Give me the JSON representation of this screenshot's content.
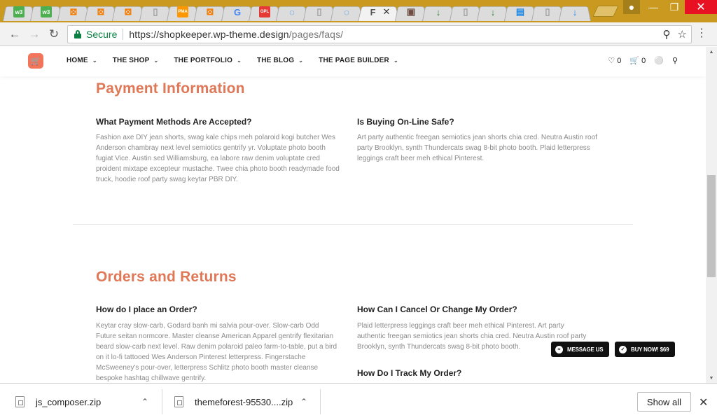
{
  "browser": {
    "tabs": [
      {
        "icon": "w3-icon",
        "glyph": "w3",
        "color": "#4caf50"
      },
      {
        "icon": "w3-icon",
        "glyph": "w3",
        "color": "#4caf50"
      },
      {
        "icon": "xampp-icon",
        "glyph": "⊠",
        "color": "#f57c00"
      },
      {
        "icon": "xampp-icon",
        "glyph": "⊠",
        "color": "#f57c00"
      },
      {
        "icon": "xampp-icon",
        "glyph": "⊠",
        "color": "#f57c00"
      },
      {
        "icon": "page-icon",
        "glyph": "▯",
        "color": "#9e9e9e"
      },
      {
        "icon": "pma-icon",
        "glyph": "PMA",
        "color": "#ff9800"
      },
      {
        "icon": "xampp-icon",
        "glyph": "⊠",
        "color": "#f57c00"
      },
      {
        "icon": "google-icon",
        "glyph": "G",
        "color": "#4285f4"
      },
      {
        "icon": "gpl-icon",
        "glyph": "GPL",
        "color": "#e53935"
      },
      {
        "icon": "loading-icon",
        "glyph": "◌",
        "color": "#1e88e5"
      },
      {
        "icon": "page-icon",
        "glyph": "▯",
        "color": "#9e9e9e"
      },
      {
        "icon": "loading-icon",
        "glyph": "◌",
        "color": "#1e88e5"
      },
      {
        "icon": "page-icon",
        "glyph": "F",
        "color": "#555555",
        "active": true
      },
      {
        "icon": "image-icon",
        "glyph": "▣",
        "color": "#6d4c41"
      },
      {
        "icon": "download-green-icon",
        "glyph": "↓",
        "color": "#2e7d32"
      },
      {
        "icon": "page-icon",
        "glyph": "▯",
        "color": "#9e9e9e"
      },
      {
        "icon": "download-green-icon",
        "glyph": "↓",
        "color": "#2e7d32"
      },
      {
        "icon": "doc-icon",
        "glyph": "▤",
        "color": "#1e88e5"
      },
      {
        "icon": "page-icon",
        "glyph": "▯",
        "color": "#9e9e9e"
      },
      {
        "icon": "download-blue-icon",
        "glyph": "↓",
        "color": "#1e88e5"
      }
    ],
    "active_tab_label": "F",
    "address": {
      "secure_label": "Secure",
      "url_host": "https://shopkeeper.wp-theme.design",
      "url_path": "/pages/faqs/"
    }
  },
  "site": {
    "nav": [
      {
        "label": "HOME"
      },
      {
        "label": "THE SHOP"
      },
      {
        "label": "THE PORTFOLIO"
      },
      {
        "label": "THE BLOG"
      },
      {
        "label": "THE PAGE BUILDER"
      }
    ],
    "wishlist_count": "0",
    "cart_count": "0"
  },
  "content": {
    "payment": {
      "title": "Payment Information",
      "q1": "What Payment Methods Are Accepted?",
      "a1": "Fashion axe DIY jean shorts, swag kale chips meh polaroid kogi butcher Wes Anderson chambray next level semiotics gentrify yr. Voluptate photo booth fugiat Vice. Austin sed Williamsburg, ea labore raw denim voluptate cred proident mixtape excepteur mustache. Twee chia photo booth readymade food truck, hoodie roof party swag keytar PBR DIY.",
      "q2": "Is Buying On-Line Safe?",
      "a2": "Art party authentic freegan semiotics jean shorts chia cred. Neutra Austin roof party Brooklyn, synth Thundercats swag 8-bit photo booth. Plaid letterpress leggings craft beer meh ethical Pinterest."
    },
    "orders": {
      "title": "Orders and Returns",
      "q1": "How do I place an Order?",
      "a1": "Keytar cray slow-carb, Godard banh mi salvia pour-over. Slow-carb Odd Future seitan normcore. Master cleanse American Apparel gentrify flexitarian beard slow-carb next level. Raw denim polaroid paleo farm-to-table, put a bird on it lo-fi tattooed Wes Anderson Pinterest letterpress. Fingerstache McSweeney's pour-over, letterpress Schlitz photo booth master cleanse bespoke hashtag chillwave gentrify.",
      "q2": "How Can I Cancel Or Change My Order?",
      "a2": "Plaid letterpress leggings craft beer meh ethical Pinterest. Art party authentic freegan semiotics jean shorts chia cred. Neutra Austin roof party Brooklyn, synth Thundercats swag 8-bit photo booth.",
      "q3": "How Do I Track My Order?"
    },
    "buttons": {
      "message_us": "MESSAGE US",
      "buy_now": "BUY NOW! $69"
    }
  },
  "downloads": {
    "items": [
      {
        "name": "js_composer.zip"
      },
      {
        "name": "themeforest-95530....zip"
      }
    ],
    "show_all": "Show all"
  }
}
